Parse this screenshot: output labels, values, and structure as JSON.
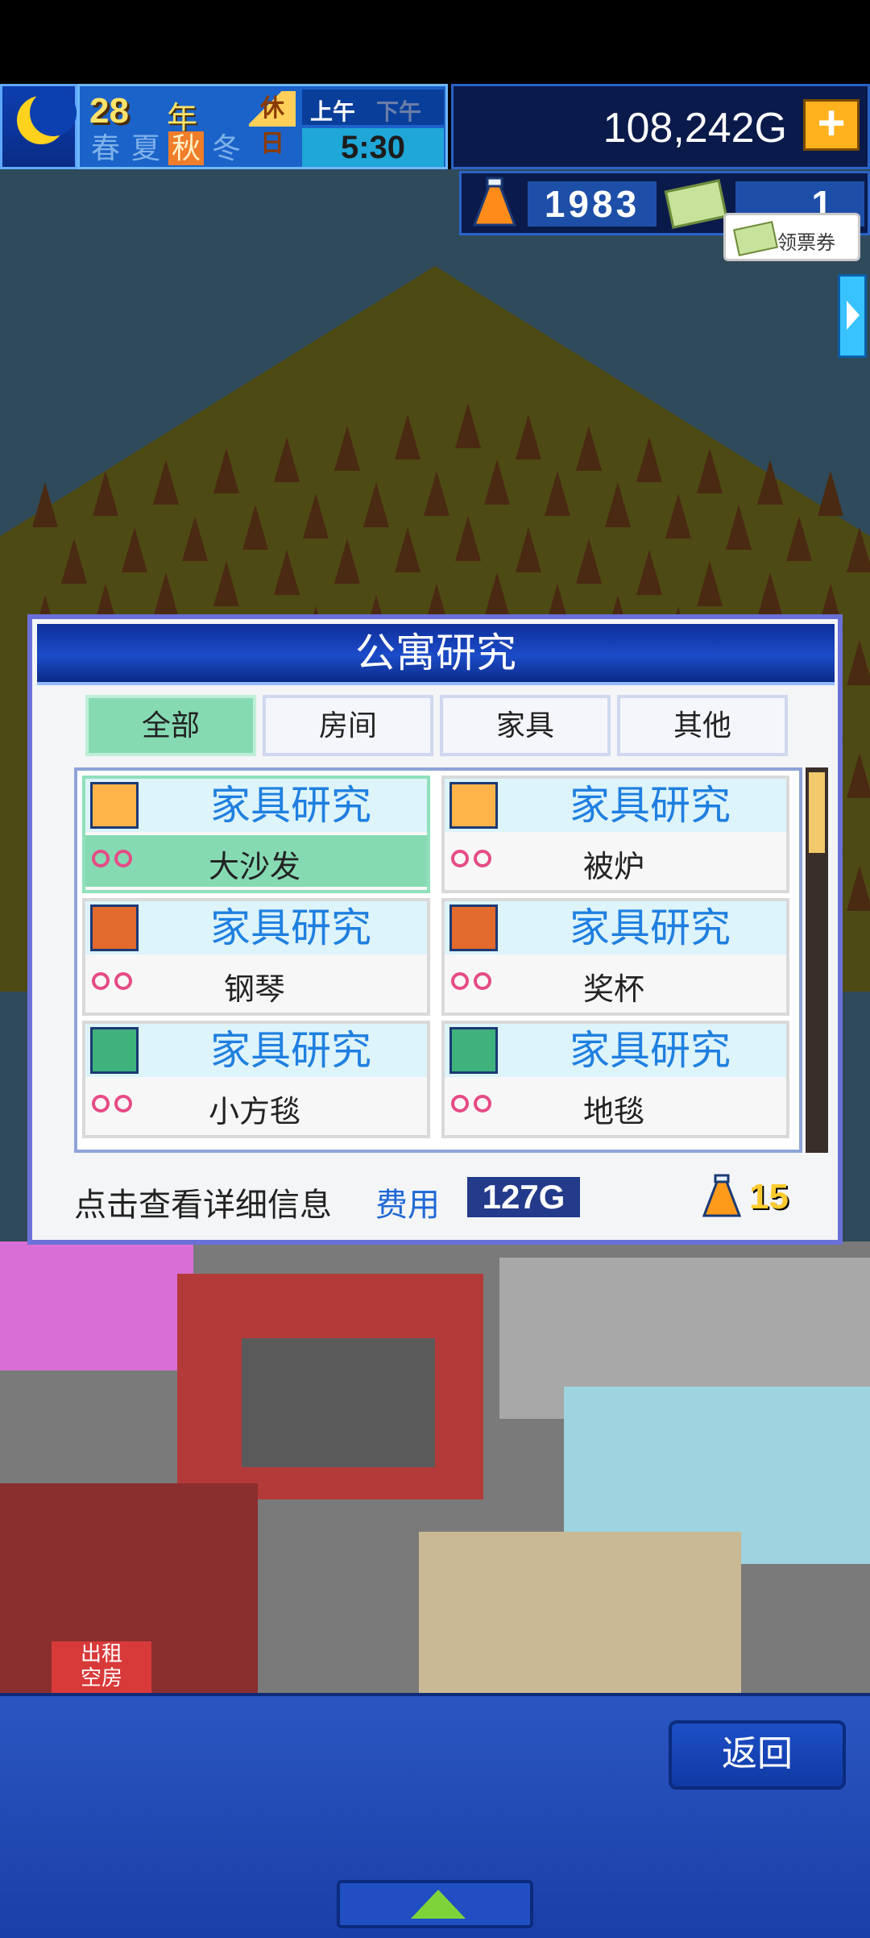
{
  "hud": {
    "year": "28",
    "year_label": "年",
    "holiday": "休日",
    "am": "上午",
    "pm": "下午",
    "seasons": [
      "春",
      "夏",
      "秋",
      "冬"
    ],
    "active_season": "秋",
    "time": "5:30",
    "money": "108,242G",
    "research_points": "1983",
    "tickets": "1",
    "voucher_label": "领票券"
  },
  "dialog": {
    "title": "公寓研究",
    "tabs": [
      "全部",
      "房间",
      "家具",
      "其他"
    ],
    "active_tab": "全部",
    "items": [
      {
        "title": "家具研究",
        "name": "大沙发",
        "icon": "sofa-icon"
      },
      {
        "title": "家具研究",
        "name": "被炉",
        "icon": "sofa-icon"
      },
      {
        "title": "家具研究",
        "name": "钢琴",
        "icon": "tv-icon"
      },
      {
        "title": "家具研究",
        "name": "奖杯",
        "icon": "tv-icon"
      },
      {
        "title": "家具研究",
        "name": "小方毯",
        "icon": "rug-icon"
      },
      {
        "title": "家具研究",
        "name": "地毯",
        "icon": "rug-icon"
      }
    ],
    "selected_index": 0,
    "hint": "点击查看详细信息",
    "cost_label": "费用",
    "cost_value": "127G",
    "required_points": "15"
  },
  "bottom": {
    "back_label": "返回"
  },
  "colors": {
    "accent": "#1f7fe0",
    "selected": "#86dab2",
    "dialog_border": "#6a70d8"
  }
}
